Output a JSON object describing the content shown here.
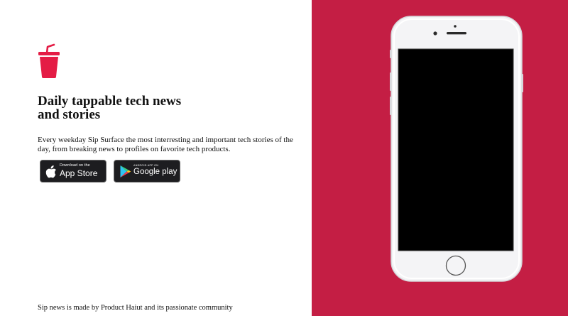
{
  "brand": {
    "logo_icon": "soda-cup-icon",
    "accent_color": "#e41c45",
    "panel_color": "#c41e44"
  },
  "hero": {
    "headline_line1": "Daily tappable tech news",
    "headline_line2": "and stories",
    "description": "Every weekday Sip Surface the most interresting and important tech stories of the day, from breaking news to profiles on favorite tech products."
  },
  "badges": {
    "appstore": {
      "small_label": "Download on the",
      "big_label": "App Store",
      "icon": "apple-icon"
    },
    "googleplay": {
      "small_label": "ANDROID APP ON",
      "big_label": "Google play",
      "icon": "play-triangle-icon"
    }
  },
  "footer": {
    "credit": "Sip news is made by Product Haiut and its passionate community"
  },
  "device": {
    "icon": "iphone-device-icon",
    "frame_color": "#f4f4f6",
    "screen_color": "#000000"
  }
}
